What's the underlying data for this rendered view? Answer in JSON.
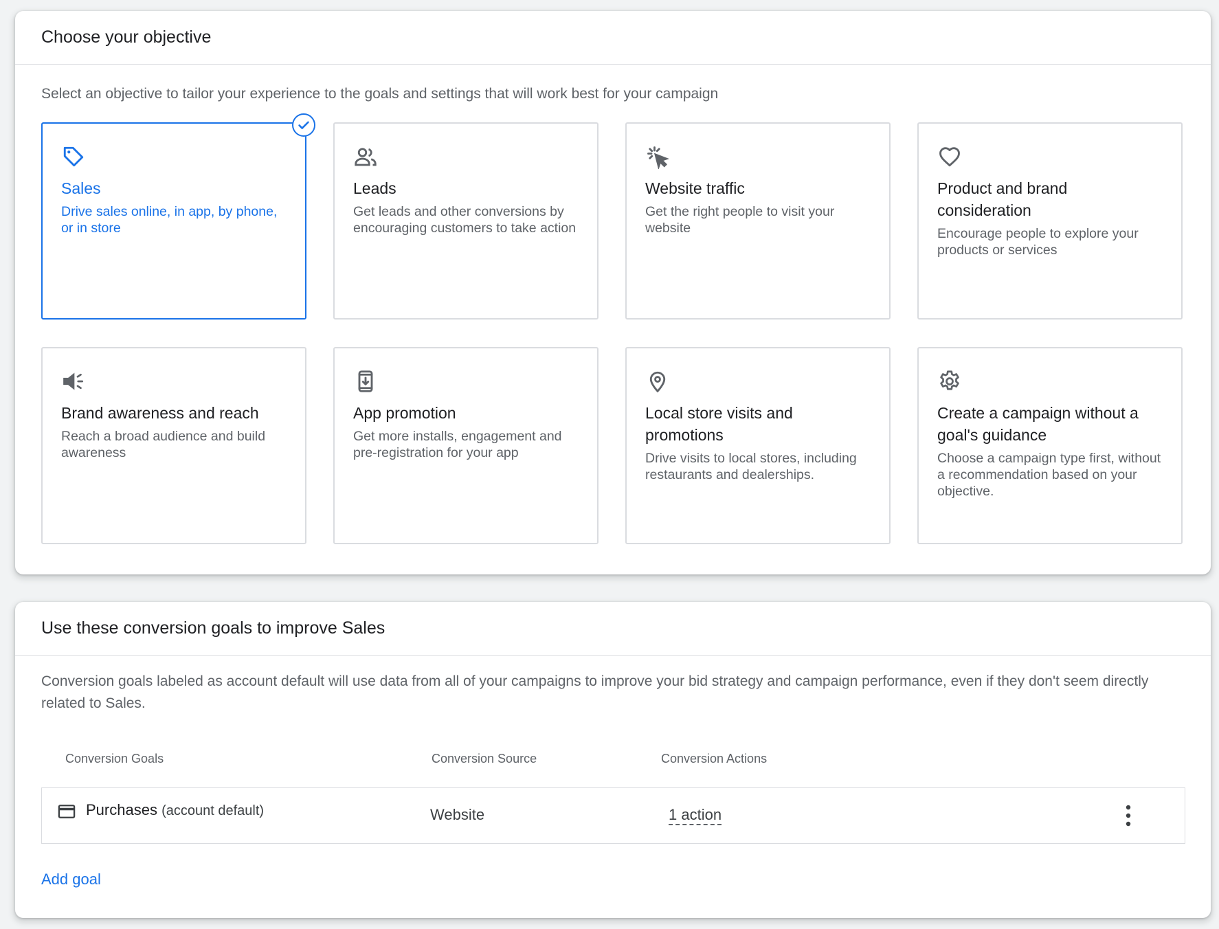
{
  "colors": {
    "accent": "#1a73e8",
    "border": "#dadce0",
    "text": "#202124",
    "muted": "#5f6368"
  },
  "objective_section": {
    "title": "Choose your objective",
    "description": "Select an objective to tailor your experience to the goals and settings that will work best for your campaign",
    "objectives": [
      {
        "icon": "tag-icon",
        "title": "Sales",
        "description": "Drive sales online, in app, by phone, or in store",
        "selected": true
      },
      {
        "icon": "people-icon",
        "title": "Leads",
        "description": "Get leads and other conversions by encouraging customers to take action",
        "selected": false
      },
      {
        "icon": "cursor-click-icon",
        "title": "Website traffic",
        "description": "Get the right people to visit your website",
        "selected": false
      },
      {
        "icon": "heart-icon",
        "title": "Product and brand consideration",
        "description": "Encourage people to explore your products or services",
        "selected": false
      },
      {
        "icon": "megaphone-icon",
        "title": "Brand awareness and reach",
        "description": "Reach a broad audience and build awareness",
        "selected": false
      },
      {
        "icon": "phone-download-icon",
        "title": "App promotion",
        "description": "Get more installs, engagement and pre-registration for your app",
        "selected": false
      },
      {
        "icon": "location-pin-icon",
        "title": "Local store visits and promotions",
        "description": "Drive visits to local stores, including restaurants and dealerships.",
        "selected": false
      },
      {
        "icon": "gear-icon",
        "title": "Create a campaign without a goal's guidance",
        "description": "Choose a campaign type first, without a recommendation based on your objective.",
        "selected": false
      }
    ]
  },
  "goals_section": {
    "title": "Use these conversion goals to improve Sales",
    "description": "Conversion goals labeled as account default will use data from all of your campaigns to improve your bid strategy and campaign performance, even if they don't seem directly related to Sales.",
    "columns": [
      "Conversion Goals",
      "Conversion Source",
      "Conversion Actions"
    ],
    "rows": [
      {
        "icon": "credit-card-icon",
        "goal": "Purchases",
        "tag": "(account default)",
        "source": "Website",
        "actions": "1 action"
      }
    ],
    "add_goal_label": "Add goal"
  }
}
